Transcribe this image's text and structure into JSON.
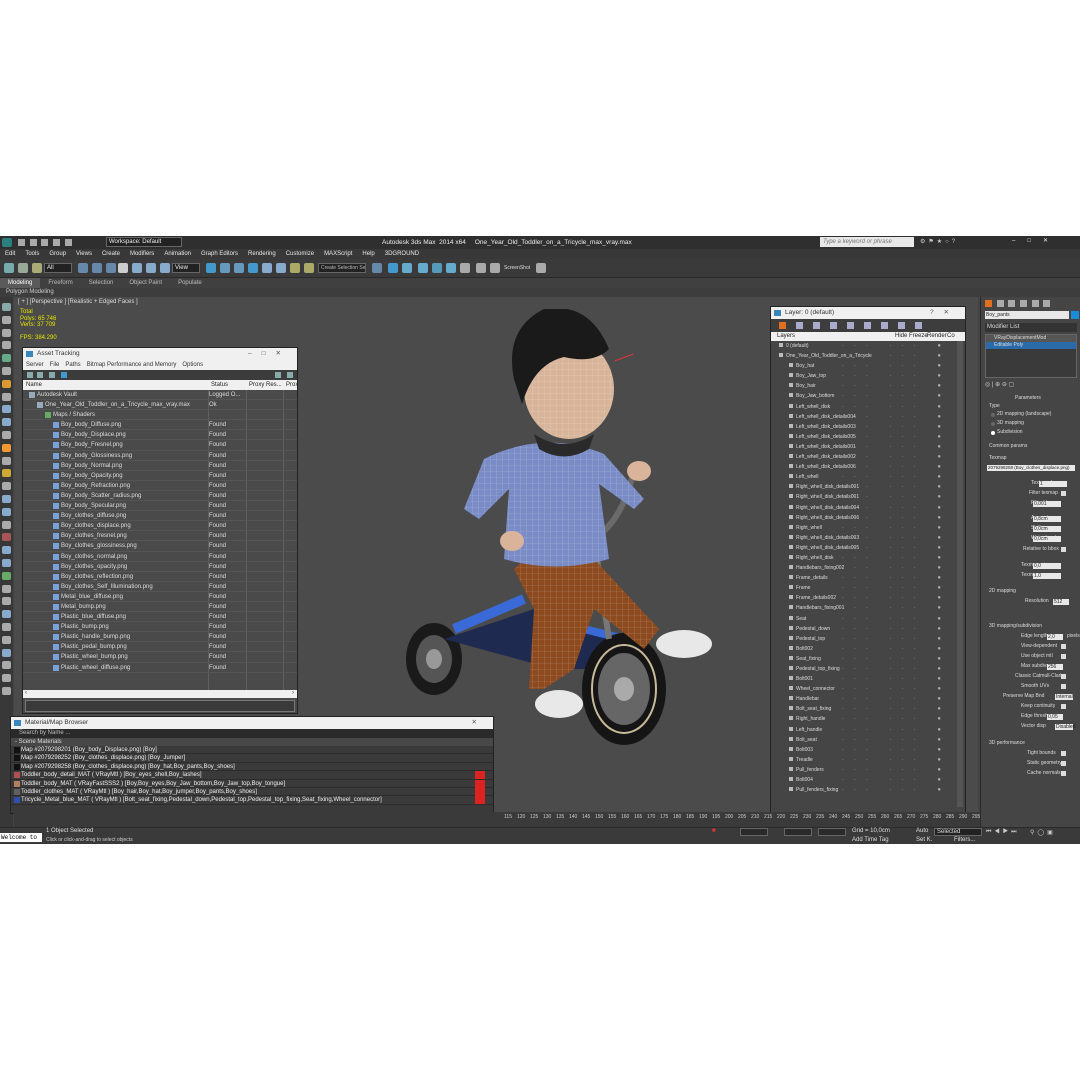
{
  "title_bar": {
    "workspace": "Workspace: Default",
    "app_title": "Autodesk 3ds Max  2014 x64     One_Year_Old_Toddler_on_a_Tricycle_max_vray.max",
    "search_placeholder": "Type a keyword or phrase"
  },
  "menu": [
    "Edit",
    "Tools",
    "Group",
    "Views",
    "Create",
    "Modifiers",
    "Animation",
    "Graph Editors",
    "Rendering",
    "Customize",
    "MAXScript",
    "Help",
    "3DGROUND"
  ],
  "toolbar": {
    "selection_filter": "All",
    "view_dropdown": "View",
    "named_sel": "Create Selection Se",
    "screenshot": "ScreenShot"
  },
  "ribbon": {
    "tabs": [
      "Modeling",
      "Freeform",
      "Selection",
      "Object Paint",
      "Populate"
    ],
    "active": "Modeling",
    "subtitle": "Polygon Modeling"
  },
  "viewport": {
    "label": "[ + ] [Perspective ] [Realistic + Edged Faces ]",
    "stats": [
      "Total",
      "Polys:  65 746",
      "Verts:  37 709",
      "",
      "FPS:   384.290"
    ]
  },
  "asset_tracking": {
    "title": "Asset Tracking",
    "menu": [
      "Server",
      "File",
      "Paths",
      "Bitmap Performance and Memory",
      "Options"
    ],
    "columns": [
      "Name",
      "Status",
      "Proxy Res...",
      "Prox"
    ],
    "rows": [
      {
        "name": "Autodesk Vault",
        "status": "Logged O...",
        "indent": 1
      },
      {
        "name": "One_Year_Old_Toddler_on_a_Tricycle_max_vray.max",
        "status": "Ok",
        "indent": 2
      },
      {
        "name": "Maps / Shaders",
        "status": "",
        "indent": 3
      },
      {
        "name": "Boy_body_Diffuse.png",
        "status": "Found",
        "indent": 4
      },
      {
        "name": "Boy_body_Displace.png",
        "status": "Found",
        "indent": 4
      },
      {
        "name": "Boy_body_Fresnel.png",
        "status": "Found",
        "indent": 4
      },
      {
        "name": "Boy_body_Glossiness.png",
        "status": "Found",
        "indent": 4
      },
      {
        "name": "Boy_body_Normal.png",
        "status": "Found",
        "indent": 4
      },
      {
        "name": "Boy_body_Opacity.png",
        "status": "Found",
        "indent": 4
      },
      {
        "name": "Boy_body_Refraction.png",
        "status": "Found",
        "indent": 4
      },
      {
        "name": "Boy_body_Scatter_radius.png",
        "status": "Found",
        "indent": 4
      },
      {
        "name": "Boy_body_Specular.png",
        "status": "Found",
        "indent": 4
      },
      {
        "name": "Boy_clothes_diffuse.png",
        "status": "Found",
        "indent": 4
      },
      {
        "name": "Boy_clothes_displace.png",
        "status": "Found",
        "indent": 4
      },
      {
        "name": "Boy_clothes_fresnel.png",
        "status": "Found",
        "indent": 4
      },
      {
        "name": "Boy_clothes_glossiness.png",
        "status": "Found",
        "indent": 4
      },
      {
        "name": "Boy_clothes_normal.png",
        "status": "Found",
        "indent": 4
      },
      {
        "name": "Boy_clothes_opacity.png",
        "status": "Found",
        "indent": 4
      },
      {
        "name": "Boy_clothes_reflection.png",
        "status": "Found",
        "indent": 4
      },
      {
        "name": "Boy_clothes_Self_Illumination.png",
        "status": "Found",
        "indent": 4
      },
      {
        "name": "Metal_blue_diffuse.png",
        "status": "Found",
        "indent": 4
      },
      {
        "name": "Metal_bump.png",
        "status": "Found",
        "indent": 4
      },
      {
        "name": "Plastic_blue_diffuse.png",
        "status": "Found",
        "indent": 4
      },
      {
        "name": "Plastic_bump.png",
        "status": "Found",
        "indent": 4
      },
      {
        "name": "Plastic_handle_bump.png",
        "status": "Found",
        "indent": 4
      },
      {
        "name": "Plastic_pedal_bump.png",
        "status": "Found",
        "indent": 4
      },
      {
        "name": "Plastic_wheel_bump.png",
        "status": "Found",
        "indent": 4
      },
      {
        "name": "Plastic_wheel_diffuse.png",
        "status": "Found",
        "indent": 4
      }
    ]
  },
  "material_browser": {
    "title": "Material/Map Browser",
    "search_placeholder": "Search by Name ...",
    "section": "- Scene Materials",
    "rows": [
      {
        "text": "Map #2079298201 (Boy_body_Displace.png) [Boy]",
        "color": "#111111",
        "red": false
      },
      {
        "text": "Map #2079298252 (Boy_clothes_displace.png) [Boy_Jumper]",
        "color": "#111111",
        "red": false
      },
      {
        "text": "Map #2079298258 (Boy_clothes_displace.png) [Boy_hat,Boy_pants,Boy_shoes]",
        "color": "#111111",
        "red": false
      },
      {
        "text": "Toddler_body_detail_MAT ( VRayMtl ) [Boy_eyes_shell,Boy_lashes]",
        "color": "#b05050",
        "red": true
      },
      {
        "text": "Toddler_body_MAT ( VRayFastSSS2 ) [Boy,Boy_eyes,Boy_Jaw_bottom,Boy_Jaw_top,Boy_tongue]",
        "color": "#b08060",
        "red": true
      },
      {
        "text": "Toddler_clothes_MAT ( VRayMtl ) [Boy_hair,Boy_hat,Boy_jumper,Boy_pants,Boy_shoes]",
        "color": "#606060",
        "red": true
      },
      {
        "text": "Tricycle_Metal_blue_MAT ( VRayMtl ) [Bolt_seat_fixing,Pedestal_down,Pedestal_top,Pedestal_top_fixing,Seat_fixing,Wheel_connector]",
        "color": "#3050b0",
        "red": true
      }
    ]
  },
  "layer_dialog": {
    "title": "Layer: 0 (default)",
    "columns": [
      "Layers",
      "Hide",
      "Freeze",
      "Render",
      "Co"
    ],
    "items": [
      "0 (default)",
      "One_Year_Old_Toddler_on_a_Tricycle",
      "Boy_hat",
      "Boy_Jaw_top",
      "Boy_hair",
      "Boy_Jaw_bottom",
      "Left_whell_disk",
      "Left_whell_disk_details004",
      "Left_whell_disk_details003",
      "Left_whell_disk_details005",
      "Left_whell_disk_details001",
      "Left_whell_disk_details002",
      "Left_whell_disk_details006",
      "Left_whell",
      "Right_whell_disk_details001",
      "Right_whell_disk_details001",
      "Right_whell_disk_details004",
      "Right_whell_disk_details006",
      "Right_whell",
      "Right_whell_disk_details003",
      "Right_whell_disk_details005",
      "Right_whell_disk",
      "Handlebars_fixing002",
      "Frame_details",
      "Frame",
      "Frame_details002",
      "Handlebars_fixing001",
      "Seat",
      "Pedestal_down",
      "Pedestal_top",
      "Bolt002",
      "Seat_fixing",
      "Pedestal_top_fixing",
      "Bolt001",
      "Wheel_connector",
      "Handlebar",
      "Bolt_seat_fixing",
      "Right_handle",
      "Left_handle",
      "Bolt_seat",
      "Bolt003",
      "Treadle",
      "Pull_fenders",
      "Bolt004",
      "Pull_fenders_fixing"
    ]
  },
  "command_panel": {
    "object_name": "Boy_pants",
    "modifier_list": "Modifier List",
    "stack": [
      "VRayDisplacementMod",
      "Editable Poly"
    ],
    "parameters": "Parameters",
    "type_label": "Type",
    "types": [
      "2D mapping (landscape)",
      "3D mapping",
      "Subdivision"
    ],
    "common_params": "Common params",
    "texmap_label": "Texmap",
    "texmap_value": "2079298258 (Boy_clothes_displace.png)",
    "fields": [
      {
        "label": "Texture chan",
        "value": "1"
      },
      {
        "label": "Filter texmap",
        "value": ""
      },
      {
        "label": "Filter blur",
        "value": "0,001"
      },
      {
        "label": "Amount",
        "value": "0,8cm"
      },
      {
        "label": "Shift",
        "value": "0,0cm"
      },
      {
        "label": "Water level",
        "value": "0,0cm"
      },
      {
        "label": "Relative to bbox",
        "value": ""
      },
      {
        "label": "Texmap min",
        "value": "0,0"
      },
      {
        "label": "Texmap max",
        "value": "1,0"
      }
    ],
    "sections": [
      "2D mapping",
      "3D mapping/subdivision",
      "3D performance"
    ],
    "resolution": {
      "label": "Resolution",
      "value": "512"
    },
    "subdiv_fields": [
      {
        "label": "Edge length",
        "value": "2,0",
        "unit": "pixels"
      },
      {
        "label": "View-dependent",
        "value": ""
      },
      {
        "label": "Use object mtl",
        "value": ""
      },
      {
        "label": "Max subdivs",
        "value": "256"
      },
      {
        "label": "Classic Catmull-Clark",
        "value": ""
      },
      {
        "label": "Smooth UVs",
        "value": ""
      },
      {
        "label": "Preserve Map Bnd",
        "value": "Internal"
      },
      {
        "label": "Keep continuity",
        "value": ""
      },
      {
        "label": "Edge thresh",
        "value": "0,05"
      },
      {
        "label": "Vector disp",
        "value": "Disabled"
      }
    ],
    "perf": [
      "Tight bounds",
      "Static geometry",
      "Cache normals"
    ]
  },
  "timeline": {
    "ticks": [
      "115",
      "120",
      "125",
      "130",
      "135",
      "140",
      "145",
      "150",
      "155",
      "160",
      "165",
      "170",
      "175",
      "180",
      "185",
      "190",
      "195",
      "200",
      "205",
      "210",
      "215",
      "220",
      "225",
      "230",
      "235",
      "240",
      "245",
      "250",
      "255",
      "260",
      "265",
      "270",
      "275",
      "280",
      "285",
      "290",
      "295"
    ]
  },
  "status": {
    "selected": "1 Object Selected",
    "hint": "Click or click-and-drag to select objects",
    "welcome": "Welcome to",
    "grid": "Grid = 10,0cm",
    "auto": "Auto",
    "selected_dd": "Selected",
    "set_k": "Set K.",
    "filters": "Filters...",
    "add_time_tag": "Add Time Tag"
  }
}
